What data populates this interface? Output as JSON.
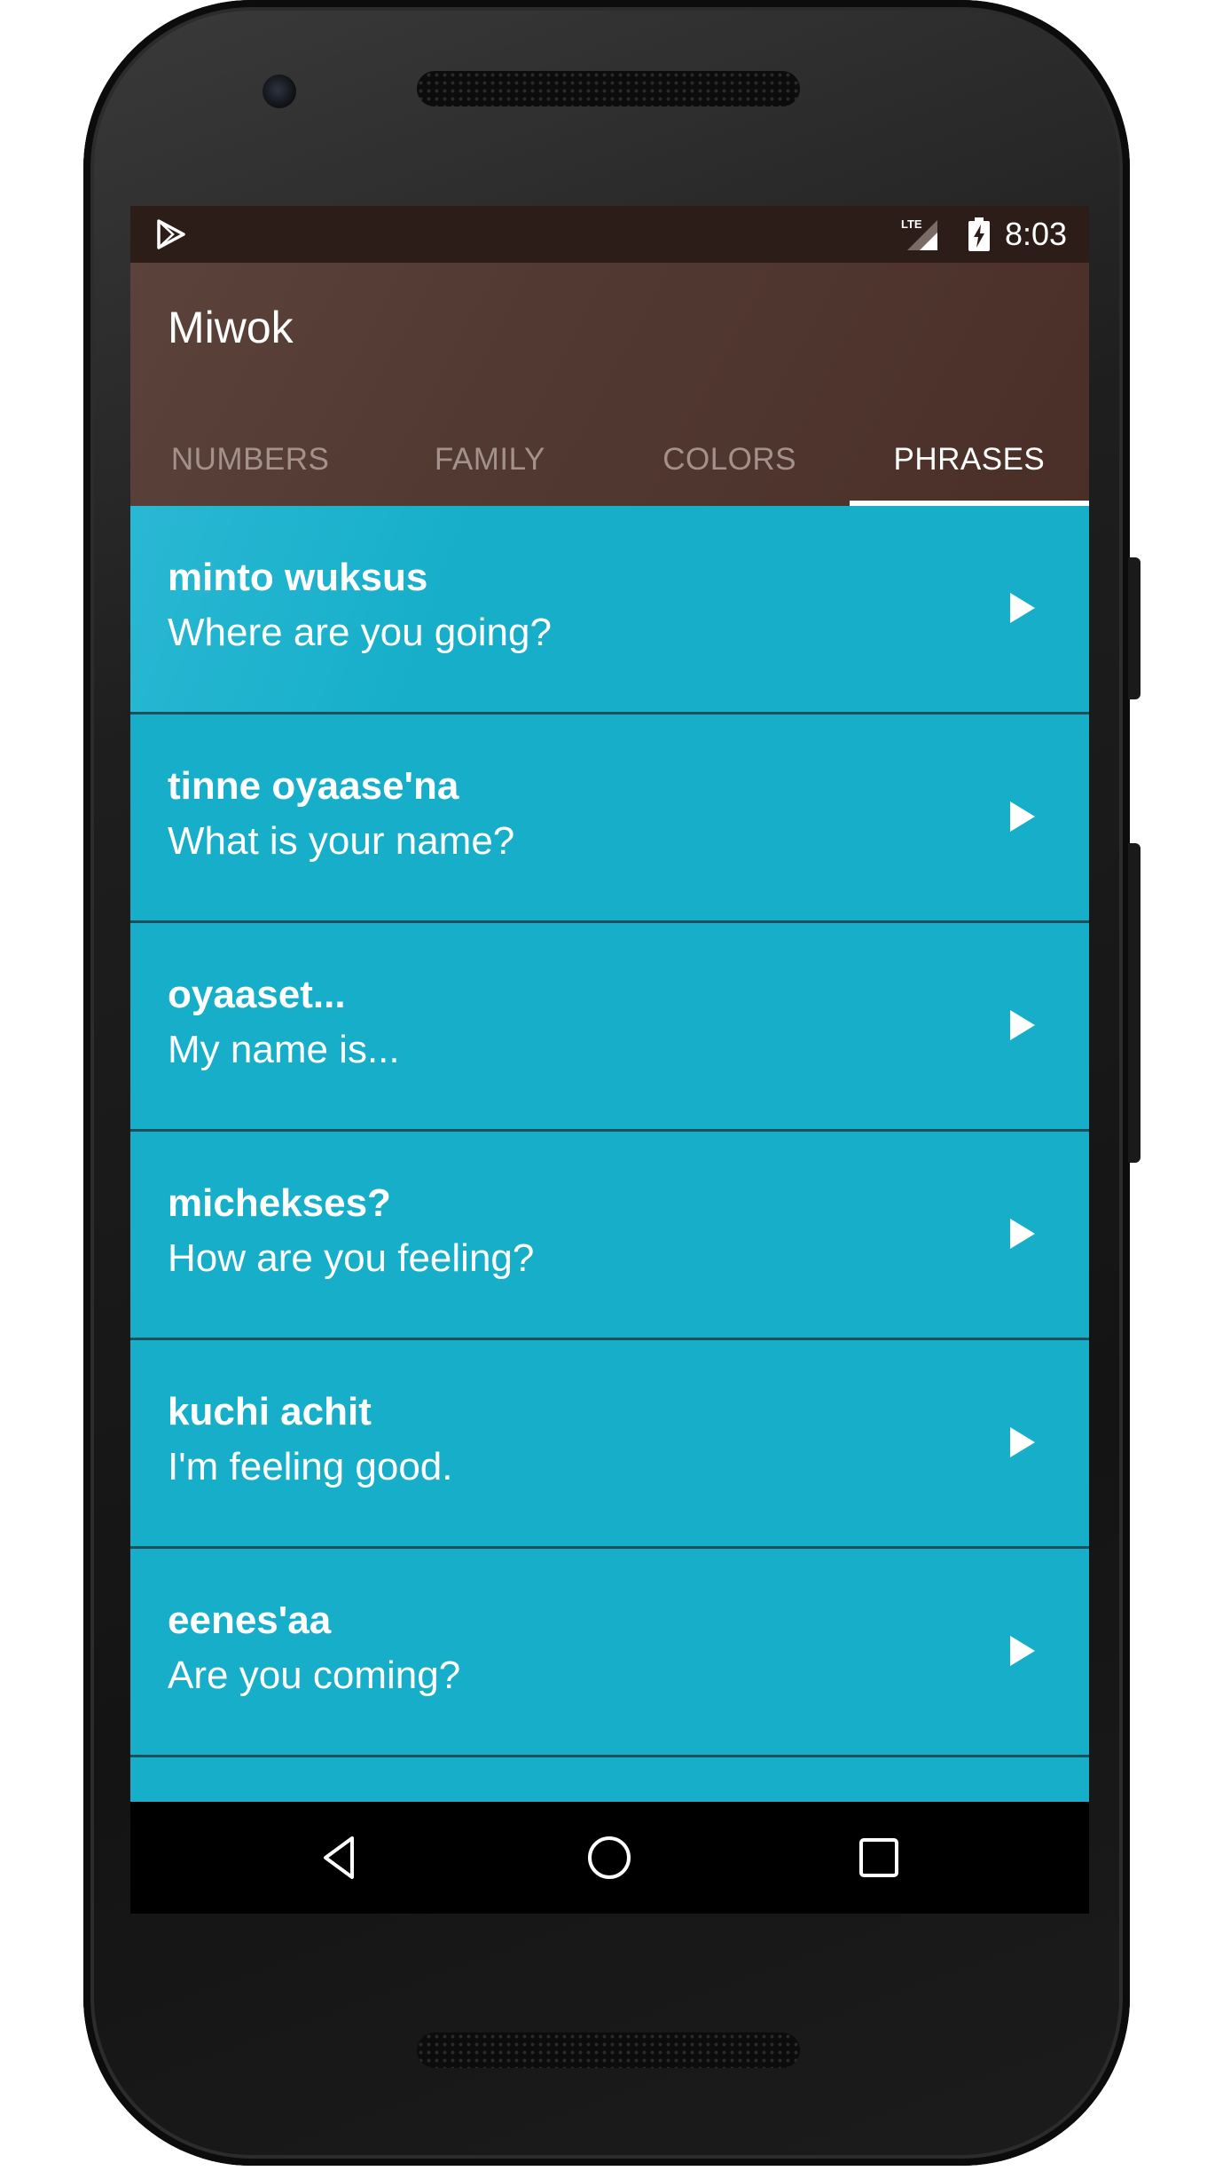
{
  "status_bar": {
    "time": "8:03",
    "network_label": "LTE",
    "icons": [
      "play-store-icon",
      "lte-signal-icon",
      "battery-charging-icon"
    ]
  },
  "app": {
    "title": "Miwok",
    "colors": {
      "app_bar": "#523a32",
      "status_bar": "#2c1d18",
      "list_background": "#16aec9",
      "tab_inactive": "#a4918b",
      "tab_active": "#ffffff"
    }
  },
  "tabs": [
    {
      "label": "NUMBERS",
      "active": false
    },
    {
      "label": "FAMILY",
      "active": false
    },
    {
      "label": "COLORS",
      "active": false
    },
    {
      "label": "PHRASES",
      "active": true
    }
  ],
  "phrases": [
    {
      "miwok": "minto wuksus",
      "english": "Where are you going?"
    },
    {
      "miwok": "tinne oyaase'na",
      "english": "What is your name?"
    },
    {
      "miwok": "oyaaset...",
      "english": "My name is..."
    },
    {
      "miwok": "michekses?",
      "english": "How are you feeling?"
    },
    {
      "miwok": "kuchi achit",
      "english": "I'm feeling good."
    },
    {
      "miwok": "eenes'aa",
      "english": "Are you coming?"
    }
  ],
  "nav_bar": {
    "icons": [
      "back-icon",
      "home-icon",
      "recents-icon"
    ]
  }
}
